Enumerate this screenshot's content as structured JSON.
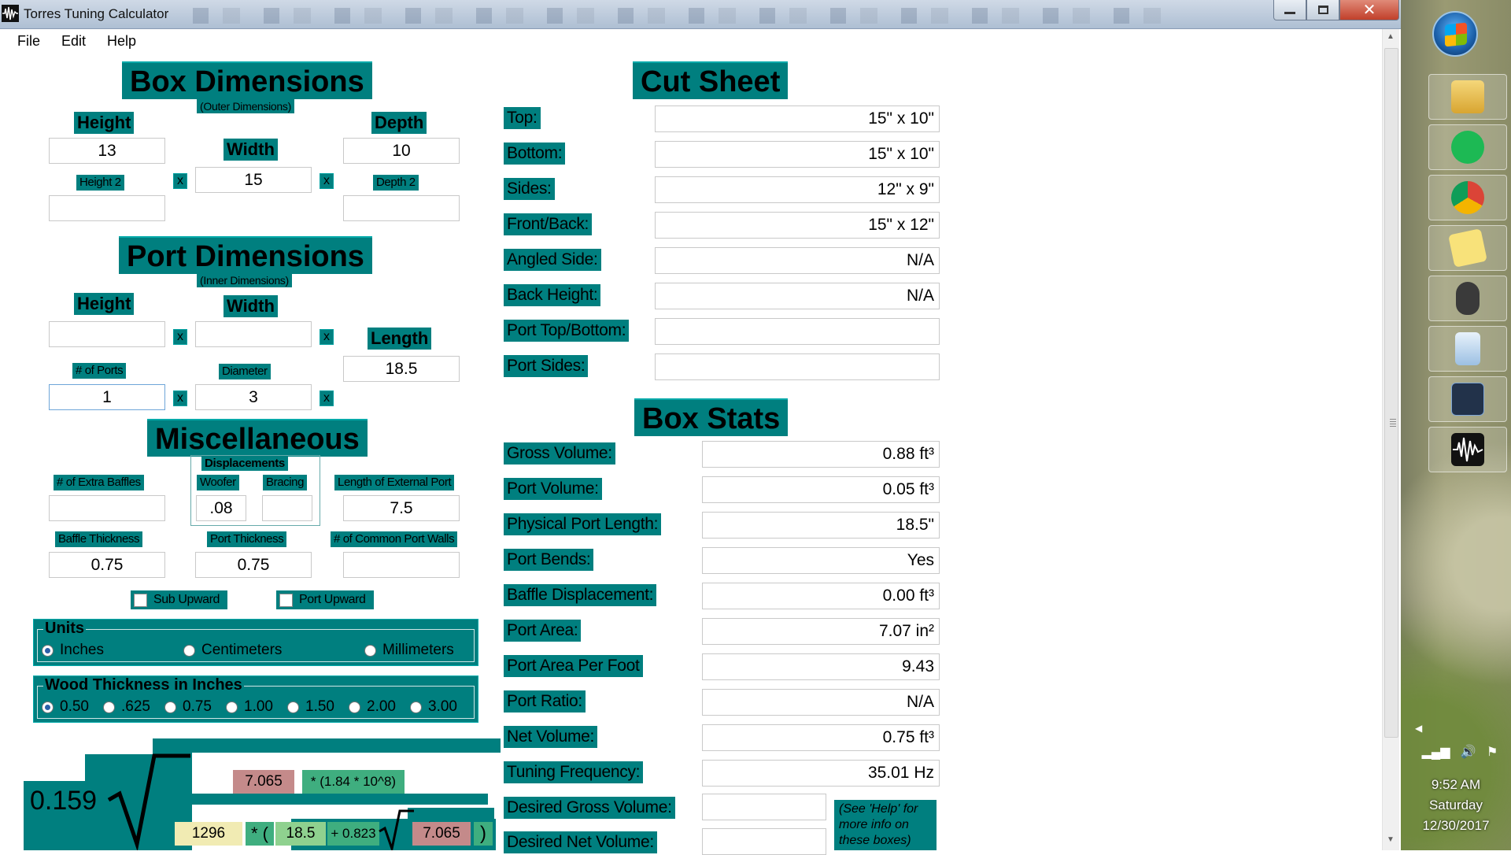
{
  "window": {
    "title": "Torres Tuning Calculator",
    "close_glyph": "✕"
  },
  "menu": [
    "File",
    "Edit",
    "Help"
  ],
  "box_dimensions": {
    "title": "Box Dimensions",
    "subtitle": "(Outer Dimensions)",
    "height_label": "Height",
    "width_label": "Width",
    "depth_label": "Depth",
    "height2_label": "Height 2",
    "depth2_label": "Depth 2",
    "height_value": "13",
    "width_value": "15",
    "depth_value": "10",
    "height2_value": "",
    "depth2_value": "",
    "x": "x"
  },
  "port_dimensions": {
    "title": "Port Dimensions",
    "subtitle": "(Inner Dimensions)",
    "height_label": "Height",
    "width_label": "Width",
    "length_label": "Length",
    "num_ports_label": "# of Ports",
    "diameter_label": "Diameter",
    "height_value": "",
    "width_value": "",
    "length_value": "18.5",
    "num_ports_value": "1",
    "diameter_value": "3"
  },
  "misc": {
    "title": "Miscellaneous",
    "displacements_label": "Displacements",
    "extra_baffles_label": "# of Extra Baffles",
    "woofer_label": "Woofer",
    "bracing_label": "Bracing",
    "ext_port_label": "Length of External Port",
    "baffle_thickness_label": "Baffle Thickness",
    "port_thickness_label": "Port Thickness",
    "common_walls_label": "# of Common Port Walls",
    "extra_baffles_value": "",
    "woofer_value": ".08",
    "bracing_value": "",
    "ext_port_value": "7.5",
    "baffle_thickness_value": "0.75",
    "port_thickness_value": "0.75",
    "common_walls_value": "",
    "sub_upward": "Sub Upward",
    "port_upward": "Port Upward"
  },
  "units": {
    "label": "Units",
    "options": [
      "Inches",
      "Centimeters",
      "Millimeters"
    ],
    "selected": "Inches"
  },
  "wood": {
    "label": "Wood Thickness in Inches",
    "options": [
      "0.50",
      ".625",
      "0.75",
      "1.00",
      "1.50",
      "2.00",
      "3.00"
    ],
    "selected": "0.50"
  },
  "formula": {
    "coef": "0.159",
    "num_value": "7.065",
    "num_text": "* (1.84 * 10^8)",
    "den_a": "1296",
    "den_star": "* (",
    "den_b": "18.5",
    "den_plus": "+ 0.823",
    "den_c": "7.065",
    "den_close": ")"
  },
  "cut_sheet": {
    "title": "Cut Sheet",
    "rows": [
      {
        "label": "Top:",
        "value": "15\" x 10\""
      },
      {
        "label": "Bottom:",
        "value": "15\" x 10\""
      },
      {
        "label": "Sides:",
        "value": "12\" x 9\""
      },
      {
        "label": "Front/Back:",
        "value": "15\" x 12\""
      },
      {
        "label": "Angled Side:",
        "value": "N/A"
      },
      {
        "label": "Back Height:",
        "value": "N/A"
      },
      {
        "label": "Port Top/Bottom:",
        "value": ""
      },
      {
        "label": "Port Sides:",
        "value": ""
      }
    ]
  },
  "box_stats": {
    "title": "Box Stats",
    "rows": [
      {
        "label": "Gross Volume:",
        "value": "0.88 ft³"
      },
      {
        "label": "Port Volume:",
        "value": "0.05 ft³"
      },
      {
        "label": "Physical Port Length:",
        "value": "18.5\""
      },
      {
        "label": "Port Bends:",
        "value": "Yes"
      },
      {
        "label": "Baffle Displacement:",
        "value": "0.00 ft³"
      },
      {
        "label": "Port Area:",
        "value": "7.07 in²"
      },
      {
        "label": "Port Area Per Foot",
        "value": "9.43"
      },
      {
        "label": "Port Ratio:",
        "value": "N/A"
      },
      {
        "label": "Net Volume:",
        "value": "0.75 ft³"
      },
      {
        "label": "Tuning Frequency:",
        "value": "35.01 Hz"
      }
    ],
    "desired_gross_label": "Desired Gross Volume:",
    "desired_net_label": "Desired Net Volume:",
    "desired_gross_value": "",
    "desired_net_value": "",
    "help_note": "(See 'Help' for more info on these boxes)"
  },
  "taskbar": {
    "time": "9:52 AM",
    "day": "Saturday",
    "date": "12/30/2017",
    "apps": [
      "windows-explorer",
      "spotify",
      "chrome",
      "sticky-notes",
      "mouse",
      "calculator",
      "winisd",
      "torres-tuning"
    ]
  }
}
